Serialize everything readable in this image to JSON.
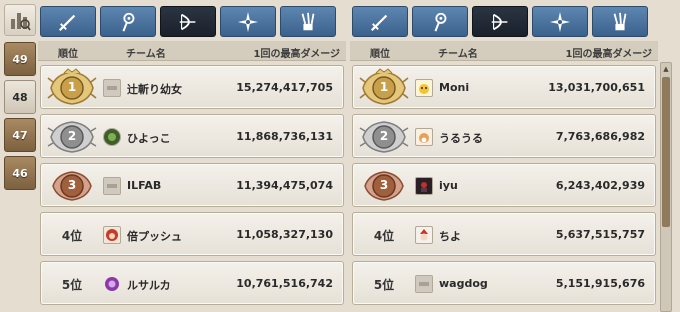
{
  "sidebar": {
    "top_icon": "ranking-chart-icon",
    "weeks": [
      {
        "label": "49",
        "active": false
      },
      {
        "label": "48",
        "active": true
      },
      {
        "label": "47",
        "active": false
      },
      {
        "label": "46",
        "active": false
      }
    ]
  },
  "tabs": [
    {
      "icon": "sword-icon",
      "active": false
    },
    {
      "icon": "magic-staff-icon",
      "active": false
    },
    {
      "icon": "bow-icon",
      "active": true
    },
    {
      "icon": "cross-shuriken-icon",
      "active": false
    },
    {
      "icon": "claw-icon",
      "active": false
    }
  ],
  "header": {
    "rank": "順位",
    "team": "チーム名",
    "damage": "1回の最高ダメージ"
  },
  "left_rows": [
    {
      "rank": "1",
      "medal": "gold",
      "avatar": "blank",
      "name": "辻斬り幼女",
      "score": "15,274,417,705"
    },
    {
      "rank": "2",
      "medal": "silver",
      "avatar": "green-orb",
      "name": "ひよっこ",
      "score": "11,868,736,131"
    },
    {
      "rank": "3",
      "medal": "bronze",
      "avatar": "blank",
      "name": "ILFAB",
      "score": "11,394,475,074"
    },
    {
      "rank": "4位",
      "medal": "none",
      "avatar": "red-creature",
      "name": "倍プッシュ",
      "score": "11,058,327,130"
    },
    {
      "rank": "5位",
      "medal": "none",
      "avatar": "purple-orb",
      "name": "ルサルカ",
      "score": "10,761,516,742"
    }
  ],
  "right_rows": [
    {
      "rank": "1",
      "medal": "gold",
      "avatar": "chick",
      "name": "Moni",
      "score": "13,031,700,651"
    },
    {
      "rank": "2",
      "medal": "silver",
      "avatar": "cat",
      "name": "うるうる",
      "score": "7,763,686,982"
    },
    {
      "rank": "3",
      "medal": "bronze",
      "avatar": "dark-character",
      "name": "iyu",
      "score": "6,243,402,939"
    },
    {
      "rank": "4位",
      "medal": "none",
      "avatar": "santa-character",
      "name": "ちよ",
      "score": "5,637,515,757"
    },
    {
      "rank": "5位",
      "medal": "none",
      "avatar": "blank",
      "name": "wagdog",
      "score": "5,151,915,676"
    }
  ],
  "colors": {
    "gold": "#c9a04a",
    "silver": "#9a9a9a",
    "bronze": "#a0603e",
    "tab_blue": "#4a72a0",
    "tab_active": "#1f2631"
  }
}
